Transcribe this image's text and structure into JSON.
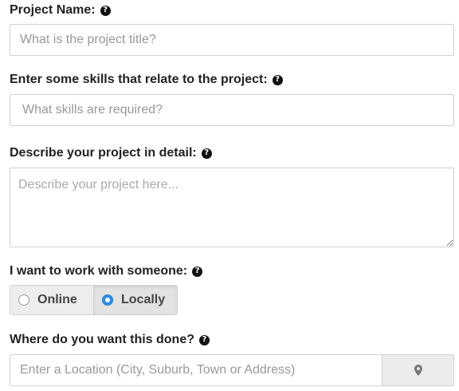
{
  "project_name": {
    "label": "Project Name:",
    "placeholder": "What is the project title?",
    "value": ""
  },
  "skills": {
    "label": "Enter some skills that relate to the project:",
    "placeholder": "What skills are required?",
    "value": ""
  },
  "description": {
    "label": "Describe your project in detail:",
    "placeholder": "Describe your project here...",
    "value": ""
  },
  "work_with": {
    "label": "I want to work with someone:",
    "options": [
      "Online",
      "Locally"
    ],
    "selected": "Locally"
  },
  "location": {
    "label": "Where do you want this done?",
    "placeholder": "Enter a Location (City, Suburb, Town or Address)",
    "value": "",
    "button_icon": "map-marker-icon"
  },
  "help_icon": {
    "glyph": "?"
  },
  "colors": {
    "radio_selected": "#2a8ef0",
    "border": "#cfcfcf"
  }
}
